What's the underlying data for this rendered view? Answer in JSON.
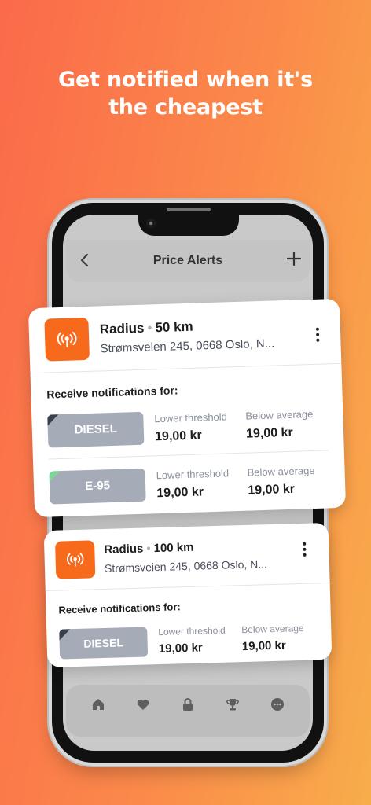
{
  "headline": {
    "line1": "Get notified when it's",
    "line2": "the cheapest"
  },
  "app": {
    "title": "Price Alerts",
    "back_icon": "chevron-left-icon",
    "add_icon": "plus-icon"
  },
  "alerts": [
    {
      "icon": "radar-icon",
      "radius_label": "Radius",
      "radius_value": "50 km",
      "address": "Strømsveien 245, 0668 Oslo, N...",
      "receive_label": "Receive notifications for:",
      "fuels": [
        {
          "name": "DIESEL",
          "corner_color": "#3a3f4c",
          "lower_label": "Lower threshold",
          "lower_value": "19,00 kr",
          "below_label": "Below average",
          "below_value": "19,00 kr"
        },
        {
          "name": "E-95",
          "corner_color": "#7fd49a",
          "lower_label": "Lower threshold",
          "lower_value": "19,00 kr",
          "below_label": "Below average",
          "below_value": "19,00 kr"
        }
      ]
    },
    {
      "icon": "radar-icon",
      "radius_label": "Radius",
      "radius_value": "100 km",
      "address": "Strømsveien 245, 0668 Oslo, N...",
      "receive_label": "Receive notifications for:",
      "fuels": [
        {
          "name": "DIESEL",
          "corner_color": "#3a3f4c",
          "lower_label": "Lower threshold",
          "lower_value": "19,00 kr",
          "below_label": "Below average",
          "below_value": "19,00 kr"
        }
      ]
    }
  ],
  "tabbar": {
    "items": [
      "home-icon",
      "heart-icon",
      "lock-icon",
      "trophy-icon",
      "more-icon"
    ]
  },
  "colors": {
    "accent": "#f76a1c",
    "pill": "#a6abb8",
    "background_start": "#fb6a4a",
    "background_end": "#f8ad4b"
  }
}
